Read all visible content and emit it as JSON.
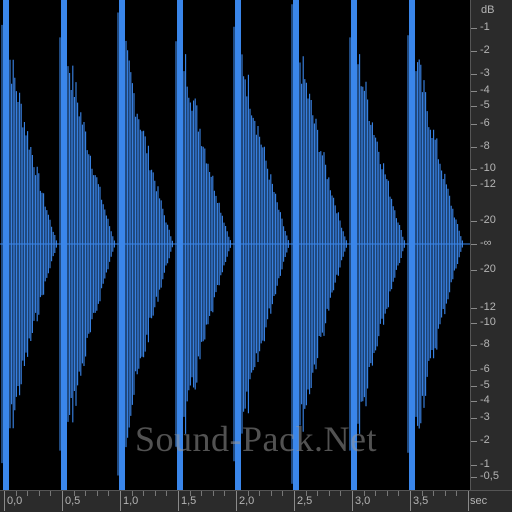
{
  "watermark": "Sound-Pack.Net",
  "colors": {
    "waveform": "#3a86ea",
    "background": "#000000",
    "ruler_bg": "#2b2b2b",
    "ruler_text": "#b4b4b4"
  },
  "db_ruler": {
    "unit": "dB",
    "labels": [
      "-1",
      "-2",
      "-3",
      "-4",
      "-5",
      "-6",
      "-8",
      "-10",
      "-12",
      "-20",
      "-∞",
      "-20",
      "-12",
      "-10",
      "-8",
      "-6",
      "-5",
      "-4",
      "-3",
      "-2",
      "-1",
      "-0,5"
    ]
  },
  "time_ruler": {
    "unit": "sec",
    "labels": [
      "0,0",
      "0,5",
      "1,0",
      "1,5",
      "2,0",
      "2,5",
      "3,0",
      "3,5"
    ]
  },
  "waveform": {
    "hit_count": 8,
    "hit_interval_sec": 0.5,
    "visible_duration_sec": 4.0
  }
}
